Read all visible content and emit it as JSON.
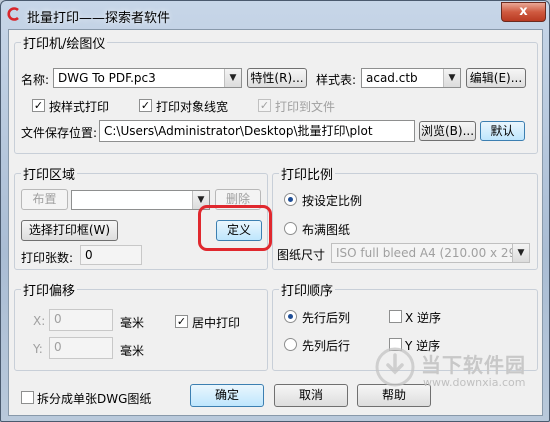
{
  "window": {
    "title": "批量打印——探索者软件",
    "close_symbol": "x"
  },
  "printer": {
    "group_title": "打印机/绘图仪",
    "name_label": "名称:",
    "name_value": "DWG To PDF.pc3",
    "properties_button": "特性(R)...",
    "style_label": "样式表:",
    "style_value": "acad.ctb",
    "edit_button": "编辑(E)...",
    "print_by_style": {
      "label": "按样式打印",
      "checked": true
    },
    "print_lineweight": {
      "label": "打印对象线宽",
      "checked": true
    },
    "print_to_file": {
      "label": "打印到文件",
      "checked": true,
      "disabled": true
    },
    "save_location_label": "文件保存位置:",
    "save_location_value": "C:\\Users\\Administrator\\Desktop\\批量打印\\plot",
    "browse_button": "浏览(B)...",
    "default_button": "默认"
  },
  "print_area": {
    "group_title": "打印区域",
    "layout_button": "布置",
    "layout_select_value": "",
    "delete_button": "删除",
    "select_frame_button": "选择打印框(W)",
    "define_button": "定义",
    "sheet_count_label": "打印张数:",
    "sheet_count_value": "0"
  },
  "print_scale": {
    "group_title": "打印比例",
    "by_ratio": {
      "label": "按设定比例",
      "selected": true
    },
    "fit_paper": {
      "label": "布满图纸",
      "selected": false
    },
    "paper_size_label": "图纸尺寸",
    "paper_size_value": "ISO full bleed A4 (210.00 x 297.0"
  },
  "print_offset": {
    "group_title": "打印偏移",
    "x_label": "X:",
    "x_value": "0",
    "y_label": "Y:",
    "y_value": "0",
    "unit": "毫米",
    "center_print": {
      "label": "居中打印",
      "checked": true
    }
  },
  "print_order": {
    "group_title": "打印顺序",
    "row_first": {
      "label": "先行后列",
      "selected": true
    },
    "col_first": {
      "label": "先列后行",
      "selected": false
    },
    "x_reverse": {
      "label": "X 逆序",
      "checked": false
    },
    "y_reverse": {
      "label": "Y 逆序",
      "checked": false
    }
  },
  "footer": {
    "split_single": {
      "label": "拆分成单张DWG图纸",
      "checked": false
    },
    "ok_button": "确定",
    "cancel_button": "取消",
    "help_button": "帮助"
  },
  "watermark": {
    "brand": "当下软件园",
    "url": "www.downxia.com"
  },
  "colors": {
    "highlight": "#e0282e",
    "accent": "#1f4e96"
  }
}
